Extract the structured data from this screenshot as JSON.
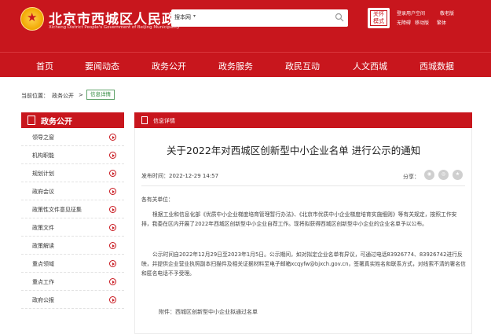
{
  "header": {
    "title": "北京市西城区人民政府",
    "subtitle": "Xicheng District People's Government of Beijing Municipality",
    "search": {
      "scope": "搜本网"
    },
    "care_badge": "关怀模式",
    "quick_links": {
      "login": "登录用户空间",
      "accessible": "无障碍",
      "mobile": "移动版",
      "edition": "敬老版",
      "traditional": "繁体"
    }
  },
  "nav": [
    "首页",
    "要闻动态",
    "政务公开",
    "政务服务",
    "政民互动",
    "人文西城",
    "西城数据"
  ],
  "breadcrumb": {
    "prefix": "当前位置：",
    "section": "政务公开",
    "sep": ">",
    "current": "信息详情"
  },
  "sidebar": {
    "title": "政务公开",
    "items": [
      "领导之窗",
      "机构职能",
      "规划计划",
      "政府会议",
      "政策性文件意见征集",
      "政策文件",
      "政策解读",
      "重点领域",
      "重点工作",
      "政府公报"
    ]
  },
  "content": {
    "header_label": "信息详情",
    "title": "关于2022年对西城区创新型中小企业名单 进行公示的通知",
    "publish_time": "发布时间：2022-12-29 14:57",
    "share_label": "分享：",
    "greeting": "各有关单位：",
    "paragraph1": "根据工业和信息化部《优质中小企业梯度培育管理暂行办法》、《北京市优质中小企业梯度培育实施细则》等有关规定，按照工作安排，我委在区内开展了2022年西城区创新型中小企业自荐工作。现将拟获得西城区创新型中小企业的企业名单予以公布。",
    "paragraph2": "公示时间自2022年12月29日至2023年1月5日。公示期间，如对拟定企业名单有异议，可通过电话83926774、83926742进行反映，并提供企业营业执照副本扫描件及相关证据材料至电子邮箱xcqyfw@bjxch.gov.cn，签署真实姓名和联系方式，对线索不清的署名信和匿名电话不予受理。",
    "attachment": "附件：西城区创新型中小企业拟通过名单"
  }
}
